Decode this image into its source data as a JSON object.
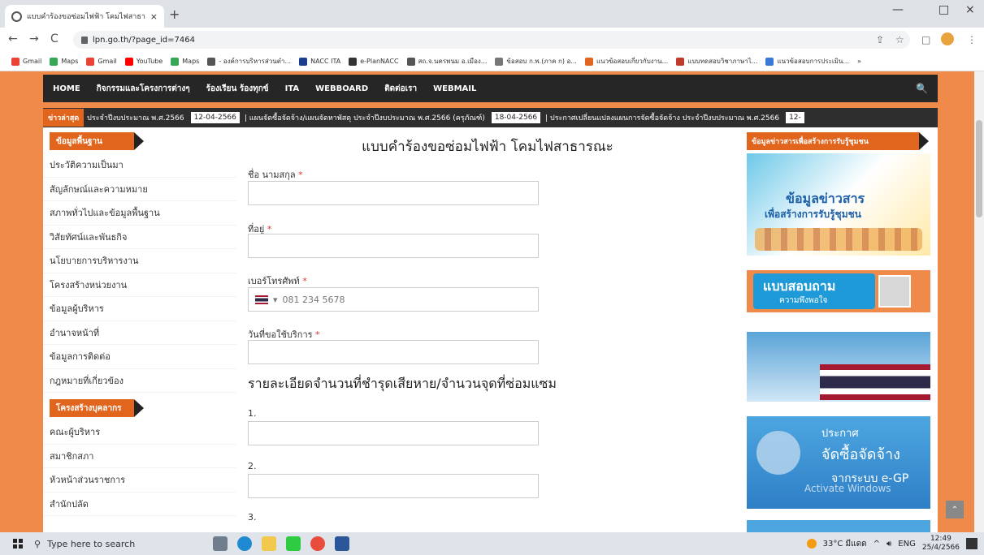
{
  "browser": {
    "tab_title": "แบบคำร้องขอซ่อมไฟฟ้า โคมไฟสาธารณ",
    "tab_close": "×",
    "new_tab": "+",
    "url": "lpn.go.th/?page_id=7464",
    "back": "←",
    "forward": "→",
    "reload": "C",
    "share": "⇪",
    "star": "☆",
    "split": "□",
    "menu": "⋮",
    "minimize": "—",
    "maximize": "□",
    "close": "×",
    "more_bookmarks": "»"
  },
  "bookmarks": [
    {
      "label": "Gmail",
      "color": "#ea4335"
    },
    {
      "label": "Maps",
      "color": "#34a853"
    },
    {
      "label": "Gmail",
      "color": "#ea4335"
    },
    {
      "label": "YouTube",
      "color": "#ff0000"
    },
    {
      "label": "Maps",
      "color": "#34a853"
    },
    {
      "label": "- องค์การบริหารส่วนตำ...",
      "color": "#555555"
    },
    {
      "label": "NACC ITA",
      "color": "#1a3d8f"
    },
    {
      "label": "e-PlanNACC",
      "color": "#333333"
    },
    {
      "label": "สถ.จ.นครพนม อ.เมือง...",
      "color": "#555555"
    },
    {
      "label": "ข้อสอบ ก.พ.(ภาค ก) อ...",
      "color": "#777777"
    },
    {
      "label": "แนวข้อสอบเกี่ยวกับงาน...",
      "color": "#e2651e"
    },
    {
      "label": "แบบทดสอบวิชาภาษาไ...",
      "color": "#c0392b"
    },
    {
      "label": "แนวข้อสอบการประเมิน...",
      "color": "#3c78d8"
    }
  ],
  "site_nav": {
    "items": [
      "HOME",
      "กิจกรรมและโครงการต่างๆ",
      "ร้องเรียน ร้องทุกข์",
      "ITA",
      "WEBBOARD",
      "ติดต่อเรา",
      "WEBMAIL"
    ],
    "search_glyph": "🔍"
  },
  "ticker": {
    "label": "ข่าวล่าสุด",
    "items": [
      {
        "text": "ประจำปีงบประมาณ พ.ศ.2566"
      },
      {
        "date": "12-04-2566",
        "text": "| แผนจัดซื้อจัดจ้าง/แผนจัดหาพัสดุ ประจำปีงบประมาณ พ.ศ.2566 (ครุภัณฑ์)"
      },
      {
        "date": "18-04-2566",
        "text": "| ประกาศเปลี่ยนแปลงแผนการจัดซื้อจัดจ้าง ประจำปีงบประมาณ พ.ศ.2566"
      },
      {
        "date": "12-"
      }
    ]
  },
  "sidebar": {
    "section1_title": "ข้อมูลพื้นฐาน",
    "section1_items": [
      "ประวัติความเป็นมา",
      "สัญลักษณ์และความหมาย",
      "สภาพทั่วไปและข้อมูลพื้นฐาน",
      "วิสัยทัศน์และพันธกิจ",
      "นโยบายการบริหารงาน",
      "โครงสร้างหน่วยงาน",
      "ข้อมูลผู้บริหาร",
      "อำนาจหน้าที่",
      "ข้อมูลการติดต่อ",
      "กฎหมายที่เกี่ยวข้อง"
    ],
    "section2_title": "โครงสร้างบุคลากร",
    "section2_items": [
      "คณะผู้บริหาร",
      "สมาชิกสภา",
      "หัวหน้าส่วนราชการ",
      "สำนักปลัด"
    ]
  },
  "form": {
    "title": "แบบคำร้องขอซ่อมไฟฟ้า โคมไฟสาธารณะ",
    "required_mark": "*",
    "name_label": "ชื่อ นามสกุล",
    "address_label": "ที่อยู่",
    "phone_label": "เบอร์โทรศัพท์",
    "phone_placeholder": "081 234 5678",
    "phone_caret": "▾",
    "date_label": "วันที่ขอใช้บริการ",
    "details_title": "รายละเอียดจำนวนที่ชำรุดเสียหาย/จำนวนจุดที่ซ่อมแซม",
    "item1": "1.",
    "item2": "2.",
    "item3": "3."
  },
  "rightcol": {
    "title": "ข้อมูลข่าวสารเพื่อสร้างการรับรู้ชุมชน",
    "banner1_line1": "ข้อมูลข่าวสาร",
    "banner1_line2": "เพื่อสร้างการรับรู้ชุมชน",
    "banner2_line1": "แบบสอบถาม",
    "banner2_line2": "ความพึงพอใจ",
    "banner4_line1": "ประกาศ",
    "banner4_line2": "จัดซื้อจัดจ้าง",
    "banner4_line3": "จากระบบ e-GP"
  },
  "watermark": "Activate Windows",
  "to_top": "⌃",
  "taskbar": {
    "search_placeholder": "Type here to search",
    "weather": "33°C มีแดด",
    "lang": "ENG",
    "time": "12:49",
    "date": "25/4/2566"
  }
}
